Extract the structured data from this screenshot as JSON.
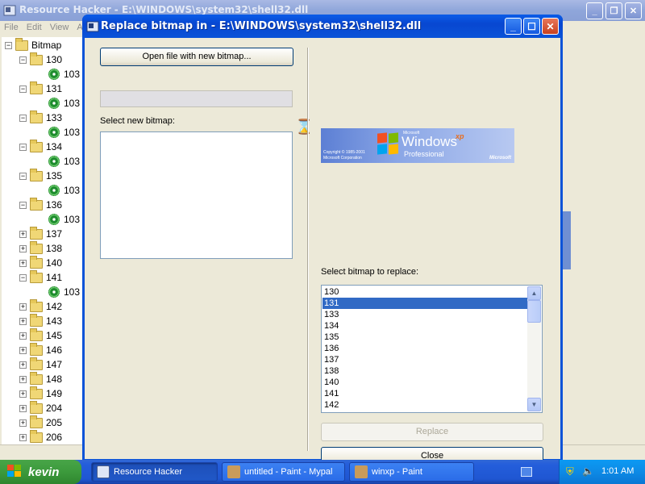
{
  "background_window": {
    "title": "Resource Hacker  -  E:\\WINDOWS\\system32\\shell32.dll",
    "menu": [
      "File",
      "Edit",
      "View",
      "A"
    ],
    "tree": {
      "root": "Bitmap",
      "items": [
        {
          "label": "130",
          "expanded": true,
          "child": "103"
        },
        {
          "label": "131",
          "expanded": true,
          "child": "103"
        },
        {
          "label": "133",
          "expanded": true,
          "child": "103"
        },
        {
          "label": "134",
          "expanded": true,
          "child": "103"
        },
        {
          "label": "135",
          "expanded": true,
          "child": "103"
        },
        {
          "label": "136",
          "expanded": true,
          "child": "103"
        },
        {
          "label": "137",
          "expanded": false
        },
        {
          "label": "138",
          "expanded": false
        },
        {
          "label": "140",
          "expanded": false
        },
        {
          "label": "141",
          "expanded": true,
          "child": "103"
        },
        {
          "label": "142",
          "expanded": false
        },
        {
          "label": "143",
          "expanded": false
        },
        {
          "label": "145",
          "expanded": false
        },
        {
          "label": "146",
          "expanded": false
        },
        {
          "label": "147",
          "expanded": false
        },
        {
          "label": "148",
          "expanded": false
        },
        {
          "label": "149",
          "expanded": false
        },
        {
          "label": "204",
          "expanded": false
        },
        {
          "label": "205",
          "expanded": false
        },
        {
          "label": "206",
          "expanded": false
        }
      ]
    }
  },
  "dialog": {
    "title": "Replace bitmap in - E:\\WINDOWS\\system32\\shell32.dll",
    "open_button": "Open file with new bitmap...",
    "select_new_label": "Select new bitmap:",
    "select_replace_label": "Select bitmap to replace:",
    "replace_list": [
      "130",
      "131",
      "133",
      "134",
      "135",
      "136",
      "137",
      "138",
      "140",
      "141",
      "142"
    ],
    "selected_index": 1,
    "replace_button": "Replace",
    "close_button": "Close",
    "preview": {
      "microsoft_small": "Microsoft",
      "windows": "Windows",
      "xp": "xp",
      "professional": "Professional",
      "copyright_1": "Copyright © 1985-2001",
      "copyright_2": "Microsoft Corporation",
      "microsoft_logo": "Microsoft"
    }
  },
  "taskbar": {
    "start_label": "kevin",
    "tasks": [
      {
        "label": "Resource Hacker",
        "active": true
      },
      {
        "label": "untitled - Paint - Mypal",
        "active": false
      },
      {
        "label": "winxp - Paint",
        "active": false
      }
    ],
    "clock": "1:01 AM"
  },
  "colors": {
    "xp_blue": "#0a53d8",
    "selection": "#316ac5",
    "start_green": "#3c9a3c",
    "tray_blue": "#0d8ae6"
  }
}
